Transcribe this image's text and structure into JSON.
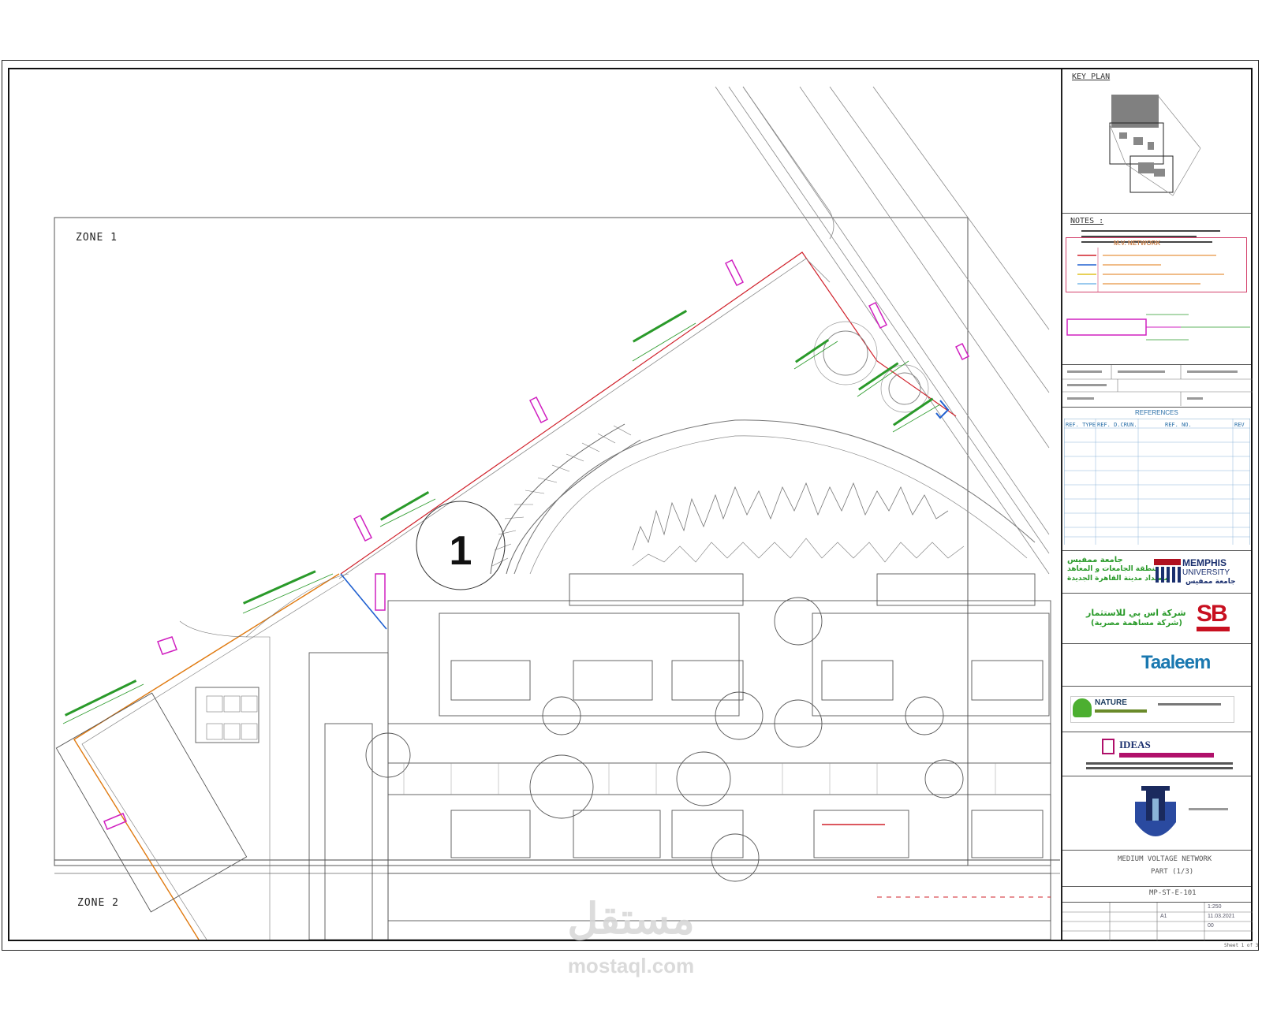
{
  "drawing": {
    "zone1_label": "ZONE 1",
    "zone2_label": "ZONE 2",
    "marker_number": "1"
  },
  "title_block": {
    "key_plan_title": "KEY PLAN",
    "notes_title": "NOTES :",
    "mv_network_title": "M.V. NETWORK",
    "references_title": "REFERENCES",
    "ref_headers": [
      "REF. TYPE",
      "REF. D.CRUN.",
      "REF. NO.",
      "REV"
    ],
    "project_title_ar_1": "جامعة ممفيس",
    "project_title_ar_2": "منطقة الجامعات و المعاهد",
    "project_title_ar_3": "بامتداد مدينة القاهرة الجديدة",
    "memphis_1": "MEMPHIS",
    "memphis_2": "UNIVERSITY",
    "memphis_ar": "جامعة ممفيس",
    "sb_ar_1": "شركة اس بي للاستثمار",
    "sb_ar_2": "(شركة مساهمة مصرية)",
    "sb_logo": "SB",
    "taaleem": "Taaleem",
    "nature": "NATURE",
    "ideas": "IDEAS",
    "sheet_title_1": "MEDIUM VOLTAGE NETWORK",
    "sheet_title_2": "PART (1/3)",
    "drawing_no": "MP-ST-E-101",
    "scale": "1:250",
    "date": "11.03.2021",
    "sheet_size": "A1",
    "revision": "00",
    "footer_tiny": "Sheet 1 of 3"
  },
  "watermark": {
    "ar": "مستقل",
    "domain": "mostaql.com"
  },
  "colors": {
    "green_label": "#2a9a2a",
    "magenta_marker": "#d020c0",
    "red_line": "#d0202a",
    "orange_line": "#e07a10",
    "blue_line": "#2060d0"
  }
}
